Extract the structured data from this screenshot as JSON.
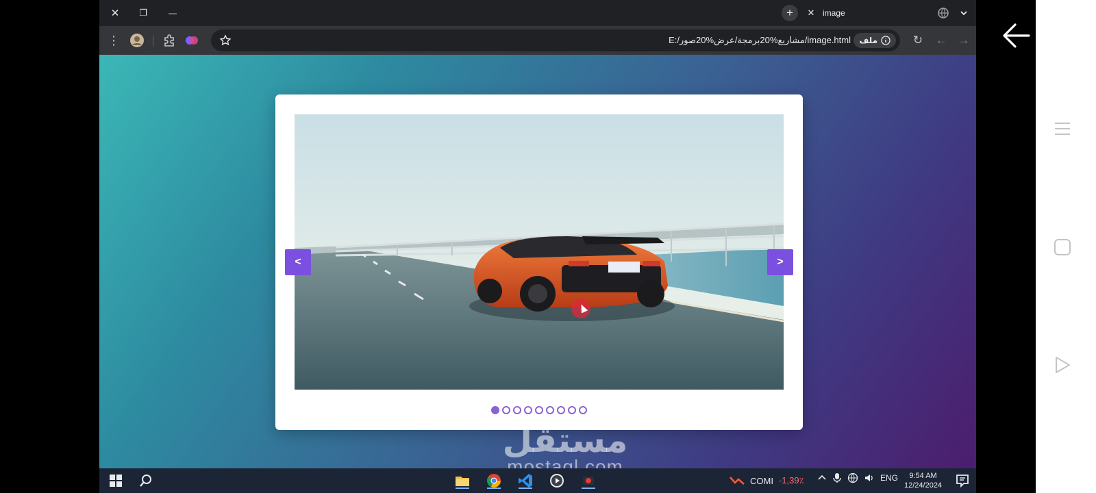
{
  "tab": {
    "title": "image",
    "close_glyph": "✕",
    "new_tab_glyph": "+"
  },
  "window_controls": {
    "close": "✕",
    "restore": "❐",
    "minimize": "—"
  },
  "address_bar": {
    "url": "E:/مشاريع%20برمجة/عرض%20صور/image.html",
    "file_chip_label": "ملف",
    "info_icon": "info-icon",
    "star_icon": "star-icon"
  },
  "toolbar": {
    "menu_glyph": "⋮",
    "reload_glyph": "↻",
    "back_glyph": "←",
    "forward_glyph": "→"
  },
  "slider": {
    "prev_label": "<",
    "next_label": ">",
    "dot_count": 9,
    "active_dot": 0
  },
  "watermark": {
    "arabic": "مستقل",
    "latin": "mostaql.com"
  },
  "taskbar": {
    "stock_name": "COMI",
    "stock_change": "-1,39٪",
    "language": "ENG",
    "time": "9:54 AM",
    "date": "12/24/2024"
  },
  "colors": {
    "accent": "#7b4fe0",
    "dot": "#8a63d2",
    "chrome_dark": "#202124",
    "toolbar": "#35363a",
    "taskbar": "#1c2535"
  }
}
